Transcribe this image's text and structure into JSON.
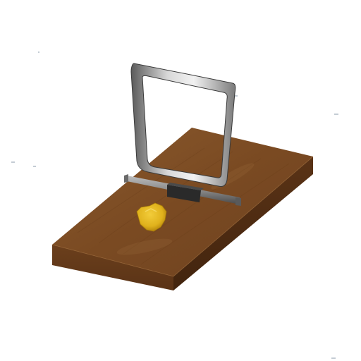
{
  "scene": {
    "subject": "mousetrap-with-cheese",
    "background_color": "#ffffff",
    "colors": {
      "wood_top": "#7a4a22",
      "wood_top_light": "#8a5a2e",
      "wood_side_front": "#6b3f1c",
      "wood_side_right": "#4f2c12",
      "metal_light": "#e8e8e8",
      "metal_mid": "#9a9a9a",
      "metal_dark": "#4a4a4a",
      "clamp": "#2a2a2a",
      "cheese": "#e0b21c",
      "cheese_shadow": "#b8880c"
    }
  }
}
